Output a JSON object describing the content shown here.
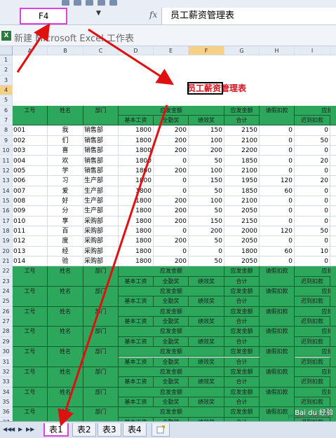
{
  "namebox": {
    "value": "F4"
  },
  "formula_bar": {
    "fx": "fx",
    "value": "员工薪资管理表",
    "dropdown": "▼"
  },
  "window": {
    "title": "新建 Microsoft Excel 工作表",
    "icon_letter": "X"
  },
  "columns": [
    "A",
    "B",
    "C",
    "D",
    "E",
    "F",
    "G",
    "H",
    "I",
    "J"
  ],
  "rows": [
    "1",
    "2",
    "3",
    "4",
    "5",
    "6",
    "7",
    "8",
    "9",
    "10",
    "11",
    "12",
    "13",
    "14",
    "15",
    "16",
    "17",
    "18",
    "19",
    "20",
    "21",
    "22",
    "23",
    "24",
    "25",
    "26",
    "27",
    "28",
    "29",
    "30",
    "31",
    "32",
    "33",
    "34",
    "35",
    "36",
    "37"
  ],
  "sheet_title": "员工薪资管理表",
  "header": {
    "id": "工号",
    "name": "姓名",
    "dept": "部门",
    "pay_group": "应发金额",
    "base": "基本工资",
    "full": "全勤奖",
    "perf": "绩效奖",
    "pay_total": "应发金额合计",
    "pay_total_1": "应发金额",
    "pay_total_2": "合计",
    "leave": "请假扣款",
    "ded_group": "应扣金额",
    "late": "迟到扣款",
    "ded_cut": "应扣"
  },
  "employees": [
    {
      "id": "001",
      "name": "我",
      "dept": "销售部",
      "base": "1800",
      "full": "200",
      "perf": "150",
      "total": "2150",
      "leave": "0",
      "late": "0"
    },
    {
      "id": "002",
      "name": "们",
      "dept": "销售部",
      "base": "1800",
      "full": "200",
      "perf": "100",
      "total": "2100",
      "leave": "0",
      "late": "50"
    },
    {
      "id": "003",
      "name": "喜",
      "dept": "销售部",
      "base": "1800",
      "full": "200",
      "perf": "200",
      "total": "2200",
      "leave": "0",
      "late": "0"
    },
    {
      "id": "004",
      "name": "欢",
      "dept": "销售部",
      "base": "1800",
      "full": "0",
      "perf": "50",
      "total": "1850",
      "leave": "0",
      "late": "20"
    },
    {
      "id": "005",
      "name": "学",
      "dept": "销售部",
      "base": "1800",
      "full": "200",
      "perf": "100",
      "total": "2100",
      "leave": "0",
      "late": "0"
    },
    {
      "id": "006",
      "name": "习",
      "dept": "生产部",
      "base": "1800",
      "full": "0",
      "perf": "150",
      "total": "1950",
      "leave": "120",
      "late": "20"
    },
    {
      "id": "007",
      "name": "爱",
      "dept": "生产部",
      "base": "1800",
      "full": "0",
      "perf": "50",
      "total": "1850",
      "leave": "60",
      "late": "0"
    },
    {
      "id": "008",
      "name": "好",
      "dept": "生产部",
      "base": "1800",
      "full": "200",
      "perf": "100",
      "total": "2100",
      "leave": "0",
      "late": "0"
    },
    {
      "id": "009",
      "name": "分",
      "dept": "生产部",
      "base": "1800",
      "full": "200",
      "perf": "50",
      "total": "2050",
      "leave": "0",
      "late": "0"
    },
    {
      "id": "010",
      "name": "享",
      "dept": "采购部",
      "base": "1800",
      "full": "200",
      "perf": "150",
      "total": "2150",
      "leave": "0",
      "late": "0"
    },
    {
      "id": "011",
      "name": "百",
      "dept": "采购部",
      "base": "1800",
      "full": "0",
      "perf": "200",
      "total": "2000",
      "leave": "120",
      "late": "50"
    },
    {
      "id": "012",
      "name": "度",
      "dept": "采购部",
      "base": "1800",
      "full": "200",
      "perf": "50",
      "total": "2050",
      "leave": "0",
      "late": "0"
    },
    {
      "id": "013",
      "name": "经",
      "dept": "采购部",
      "base": "1800",
      "full": "0",
      "perf": "0",
      "total": "1800",
      "leave": "60",
      "late": "10"
    },
    {
      "id": "014",
      "name": "验",
      "dept": "采购部",
      "base": "1800",
      "full": "200",
      "perf": "50",
      "total": "2050",
      "leave": "0",
      "late": "0"
    }
  ],
  "tabs": [
    "表1",
    "表2",
    "表3",
    "表4"
  ],
  "nav": [
    "◀◀",
    "◀",
    "▶",
    "▶▶"
  ],
  "watermark": {
    "line1": "Bai du 经验",
    "line2": "jingyan.baidu.com"
  },
  "colors": {
    "header_green": "#2ca75c",
    "title_red": "#d0121b",
    "highlight": "#e040e0",
    "arrow": "#e01010"
  }
}
